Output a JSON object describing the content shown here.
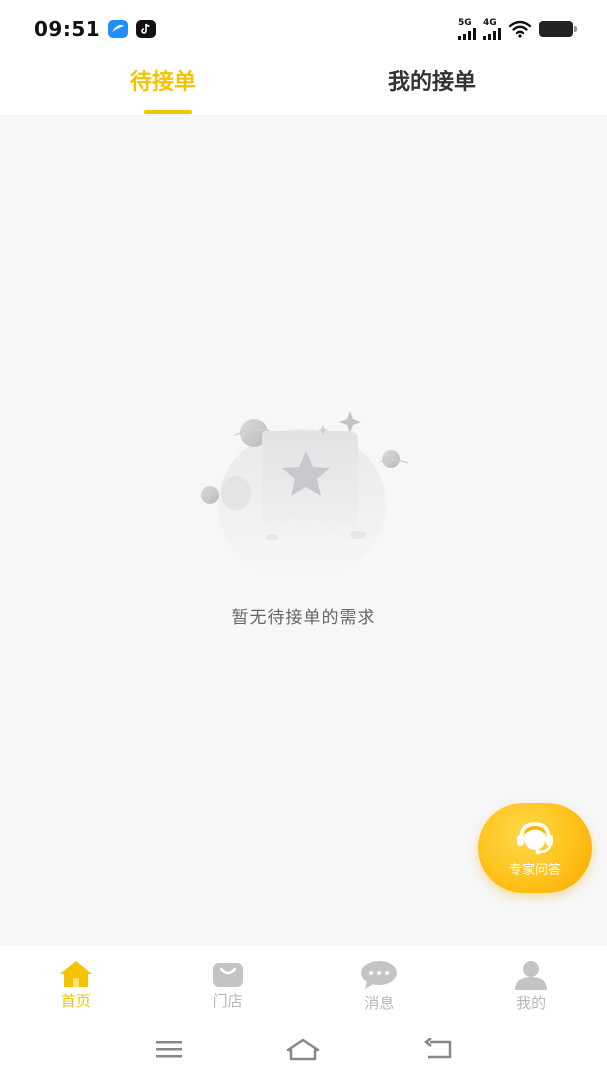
{
  "status_bar": {
    "time": "09:51",
    "signal_1_label": "5G",
    "signal_2_label": "4G"
  },
  "tabs": [
    {
      "label": "待接单",
      "active": true
    },
    {
      "label": "我的接单",
      "active": false
    }
  ],
  "empty_state": {
    "message": "暂无待接单的需求"
  },
  "expert_button": {
    "label": "专家问答"
  },
  "bottom_nav": [
    {
      "label": "首页",
      "icon": "home-icon",
      "active": true
    },
    {
      "label": "门店",
      "icon": "store-bag-icon",
      "active": false
    },
    {
      "label": "消息",
      "icon": "message-icon",
      "active": false
    },
    {
      "label": "我的",
      "icon": "profile-icon",
      "active": false
    }
  ],
  "colors": {
    "accent": "#f5c400",
    "inactive": "#b8b8b8",
    "background": "#f7f7f7"
  }
}
